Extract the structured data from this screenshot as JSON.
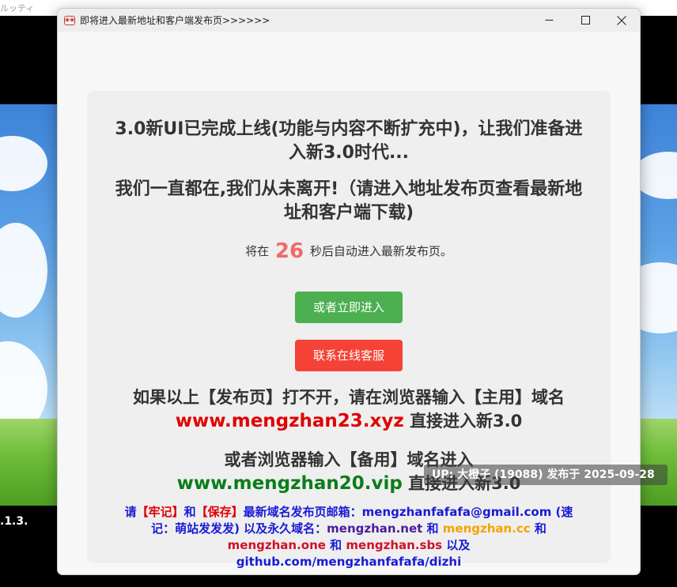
{
  "background": {
    "top_text": "ルッティ",
    "version_text": ".1.3."
  },
  "uploader_badge": "UP: 大橙子 (19088) 发布于 2025-09-28",
  "window": {
    "title": "即将进入最新地址和客户端发布页>>>>>>",
    "icon_glyph": "◉◉",
    "controls": {
      "minimize": "minimize-icon",
      "maximize": "maximize-icon",
      "close": "close-icon"
    }
  },
  "content": {
    "headline1": "3.0新UI已完成上线(功能与内容不断扩充中)，让我们准备进入新3.0时代...",
    "headline2": "我们一直都在,我们从未离开!（请进入地址发布页查看最新地址和客户端下载)",
    "countdown_prefix": "将在",
    "countdown_seconds": "26",
    "countdown_suffix": "秒后自动进入最新发布页。",
    "enter_button": "或者立即进入",
    "support_button": "联系在线客服",
    "info1_prefix": "如果以上【发布页】打不开，请在浏览器输入【主用】域名",
    "info1_domain": "www.mengzhan23.xyz",
    "info1_suffix": "直接进入新3.0",
    "info2_prefix": "或者浏览器输入【备用】域名进入",
    "info2_domain": "www.mengzhan20.vip",
    "info2_suffix": "直接进入新3.0",
    "note": {
      "p1": "请",
      "p2": "【牢记】",
      "p3": "和",
      "p4": "【保存】",
      "p5": "最新域名发布页邮箱：mengzhanfafafa@gmail.com (速记：萌站发发发) 以及永久域名：",
      "d1": "mengzhan.net",
      "p6": " 和 ",
      "d2": "mengzhan.cc",
      "p7": " 和 ",
      "d3": "mengzhan.one",
      "p8": " 和 ",
      "d4": "mengzhan.sbs",
      "p9": " 以及 github.com/mengzhanfafafa/dizhi"
    }
  },
  "colors": {
    "green_button": "#4caf50",
    "red_button": "#f44336",
    "countdown": "#f06a6a",
    "primary_domain": "#e00000",
    "backup_domain": "#0b7d1b"
  }
}
